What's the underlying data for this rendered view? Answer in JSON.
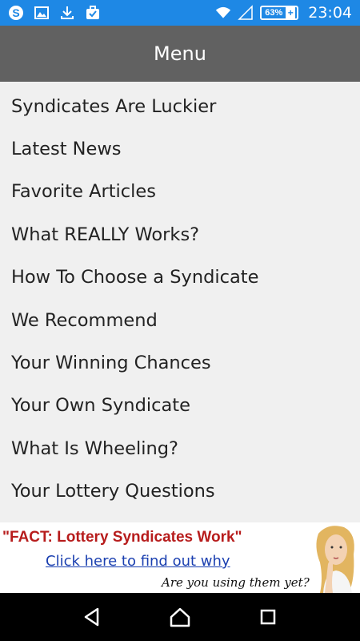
{
  "status_bar": {
    "icons_left": [
      "sync-icon",
      "image-icon",
      "download-icon",
      "briefcase-check-icon"
    ],
    "battery_percent": "63%",
    "time": "23:04"
  },
  "header": {
    "title": "Menu"
  },
  "menu": {
    "items": [
      "Syndicates Are Luckier",
      "Latest News",
      "Favorite Articles",
      "What REALLY Works?",
      "How To Choose a Syndicate",
      "We Recommend",
      "Your Winning Chances",
      "Your Own Syndicate",
      "What Is Wheeling?",
      "Your Lottery Questions"
    ]
  },
  "ad": {
    "headline": "\"FACT: Lottery Syndicates Work\"",
    "link": "Click here to find out why",
    "subtext": "Are you using them yet?"
  },
  "colors": {
    "status_bar": "#1e88e5",
    "header": "#616161",
    "background": "#f0f0f0",
    "ad_headline": "#b71c1c",
    "ad_link": "#1a3fb0"
  }
}
